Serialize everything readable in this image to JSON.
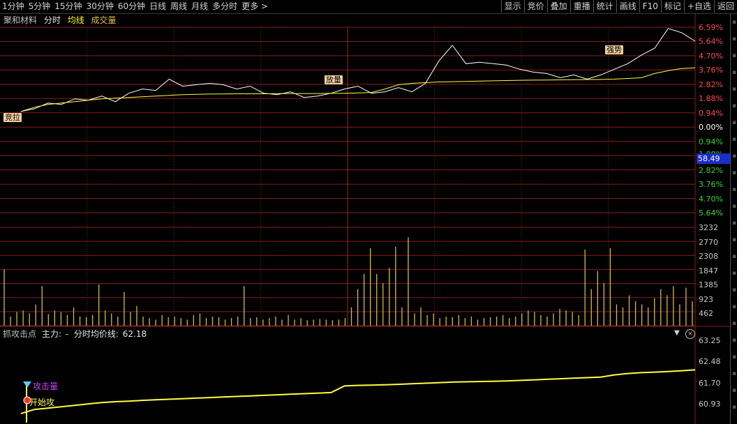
{
  "toolbar": {
    "periods": [
      "1分钟",
      "5分钟",
      "15分钟",
      "30分钟",
      "60分钟",
      "日线",
      "周线",
      "月线",
      "多分时",
      "更多 >"
    ],
    "buttons": [
      "显示",
      "竞价",
      "叠加",
      "重播",
      "统计",
      "画线",
      "F10",
      "标记",
      "+自选",
      "返回"
    ]
  },
  "title_row": {
    "stock_name": "聚和材料",
    "fenshi": "分时",
    "junxian": "均线",
    "chengjiao": "成交量"
  },
  "price_axis": {
    "up": [
      "6.59%",
      "5.64%",
      "4.70%",
      "3.76%",
      "2.82%",
      "1.88%",
      "0.94%"
    ],
    "zero": "0.00%",
    "down": [
      "0.94%",
      "1.88%",
      "2.82%",
      "3.76%",
      "4.70%",
      "5.64%"
    ],
    "current_price": "58.49"
  },
  "volume_axis": [
    "3232",
    "2770",
    "2308",
    "1847",
    "1385",
    "923",
    "462"
  ],
  "indicator": {
    "name": "抓攻击点",
    "zhuli": "主力:",
    "zhuli_value": "-",
    "avg_label": "分时均价线:",
    "avg_value": "62.18",
    "axis": [
      "63.25",
      "62.48",
      "61.70",
      "60.93"
    ],
    "signal_1": "攻击量",
    "signal_2": "开始攻"
  },
  "flags": {
    "jingla": "竞拉",
    "fangliang": "放量",
    "qiangshi": "强势"
  },
  "colors": {
    "grid": "#8a1c1c",
    "price_line": "#ffffff",
    "avg_line": "#ffff40",
    "volume": "#d4c030",
    "up_text": "#ff4a4a",
    "down_text": "#35d635"
  },
  "chart_data": [
    {
      "type": "line",
      "title": "",
      "ylabel": "",
      "ylim_pct": [
        -6.59,
        6.59
      ],
      "x": [
        0,
        1,
        2,
        3,
        4,
        5,
        6,
        7,
        8,
        9,
        10,
        11,
        12,
        13,
        14,
        15,
        16,
        17,
        18,
        19,
        20,
        21,
        22,
        23,
        24,
        25,
        26,
        27,
        28,
        29,
        30,
        31,
        32,
        33,
        34,
        35,
        36,
        37,
        38,
        39,
        40,
        41,
        42,
        43,
        44,
        45,
        46,
        47,
        48,
        49,
        50
      ],
      "series": [
        {
          "values": [
            0.6,
            0.8,
            1.2,
            1.1,
            1.5,
            1.4,
            1.7,
            1.3,
            1.9,
            2.2,
            2.1,
            2.9,
            2.4,
            2.5,
            2.6,
            2.5,
            2.2,
            2.4,
            1.9,
            1.8,
            2.0,
            1.6,
            1.7,
            1.9,
            2.2,
            2.4,
            1.9,
            2.0,
            2.3,
            2.0,
            2.6,
            4.2,
            5.3,
            4.0,
            4.1,
            4.0,
            3.9,
            3.6,
            3.4,
            3.3,
            3.0,
            3.2,
            2.9,
            3.2,
            3.6,
            4.0,
            4.6,
            5.1,
            6.5,
            6.2,
            5.6
          ]
        },
        {
          "values": [
            0.6,
            0.9,
            1.1,
            1.2,
            1.3,
            1.4,
            1.5,
            1.55,
            1.6,
            1.65,
            1.7,
            1.75,
            1.8,
            1.82,
            1.84,
            1.85,
            1.86,
            1.86,
            1.86,
            1.87,
            1.88,
            1.88,
            1.88,
            1.89,
            1.9,
            1.92,
            1.95,
            2.2,
            2.5,
            2.6,
            2.65,
            2.7,
            2.72,
            2.74,
            2.76,
            2.78,
            2.8,
            2.82,
            2.83,
            2.84,
            2.85,
            2.86,
            2.87,
            2.88,
            2.9,
            2.95,
            3.0,
            3.3,
            3.5,
            3.65,
            3.7
          ]
        }
      ]
    },
    {
      "type": "bar",
      "title": "",
      "ylim": [
        0,
        3232
      ],
      "values": [
        1850,
        300,
        450,
        500,
        400,
        700,
        1300,
        380,
        500,
        450,
        350,
        600,
        300,
        280,
        350,
        1350,
        500,
        400,
        300,
        1100,
        450,
        650,
        300,
        250,
        200,
        350,
        280,
        300,
        250,
        200,
        350,
        400,
        250,
        300,
        280,
        200,
        250,
        300,
        1300,
        250,
        280,
        200,
        250,
        300,
        200,
        350,
        200,
        250,
        180,
        200,
        220,
        200,
        180,
        200,
        250,
        600,
        1200,
        1700,
        2550,
        1700,
        1400,
        1900,
        2600,
        600,
        2900,
        400,
        600,
        350,
        400,
        250,
        300,
        280,
        350,
        250,
        300,
        200,
        250,
        280,
        300,
        350,
        250,
        300,
        400,
        500,
        450,
        350,
        300,
        400,
        550,
        500,
        450,
        350,
        2500,
        1200,
        1800,
        1400,
        2550,
        700,
        600,
        1000,
        800,
        700,
        600,
        900,
        1200,
        1000,
        1300,
        700,
        1250,
        800
      ]
    },
    {
      "type": "line",
      "title": "",
      "ylim": [
        60.93,
        63.25
      ],
      "values": [
        60.6,
        60.75,
        60.8,
        60.85,
        60.9,
        60.95,
        61.0,
        61.03,
        61.05,
        61.08,
        61.1,
        61.12,
        61.14,
        61.16,
        61.18,
        61.2,
        61.22,
        61.24,
        61.26,
        61.28,
        61.3,
        61.32,
        61.34,
        61.36,
        61.6,
        61.62,
        61.63,
        61.64,
        61.66,
        61.68,
        61.7,
        61.72,
        61.74,
        61.75,
        61.76,
        61.77,
        61.78,
        61.8,
        61.82,
        61.84,
        61.86,
        61.88,
        61.9,
        61.92,
        62.0,
        62.05,
        62.08,
        62.1,
        62.12,
        62.15,
        62.18
      ]
    }
  ]
}
